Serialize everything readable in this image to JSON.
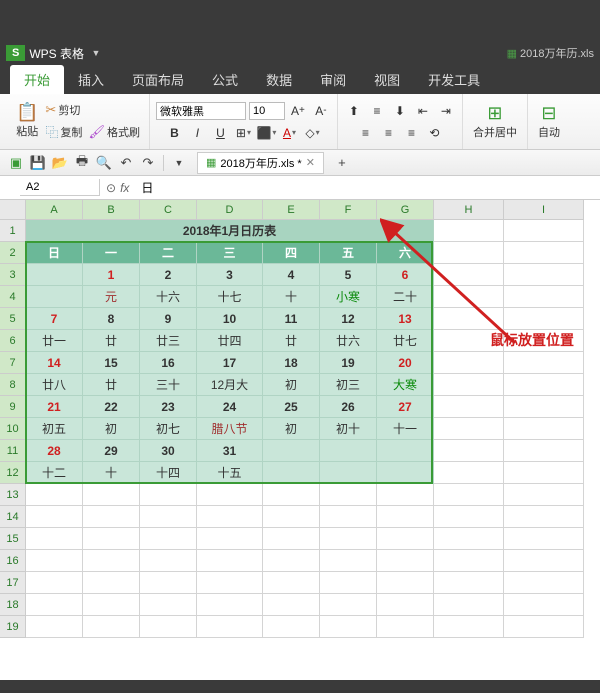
{
  "app": {
    "logo": "S",
    "title": "WPS 表格",
    "filename": "2018万年历.xls"
  },
  "menu": {
    "items": [
      "开始",
      "插入",
      "页面布局",
      "公式",
      "数据",
      "审阅",
      "视图",
      "开发工具"
    ],
    "active": 0
  },
  "ribbon": {
    "paste": "粘贴",
    "cut": "剪切",
    "copy": "复制",
    "format_painter": "格式刷",
    "font_name": "微软雅黑",
    "font_size": "10",
    "merge_center": "合并居中",
    "auto_wrap": "自动"
  },
  "qat": {
    "doc_tab": "2018万年历.xls *"
  },
  "name_box": "A2",
  "formula_value": "日",
  "col_headers": [
    "A",
    "B",
    "C",
    "D",
    "E",
    "F",
    "G",
    "H",
    "I"
  ],
  "row_headers": [
    "1",
    "2",
    "3",
    "4",
    "5",
    "6",
    "7",
    "8",
    "9",
    "10",
    "11",
    "12",
    "13",
    "14",
    "15",
    "16",
    "17",
    "18",
    "19"
  ],
  "calendar": {
    "title": "2018年1月日历表",
    "weekdays": [
      "日",
      "一",
      "二",
      "三",
      "四",
      "五",
      "六"
    ],
    "rows": [
      [
        {
          "t": ""
        },
        {
          "t": "1",
          "c": "red"
        },
        {
          "t": "2",
          "c": "bold"
        },
        {
          "t": "3",
          "c": "bold"
        },
        {
          "t": "4",
          "c": "bold"
        },
        {
          "t": "5",
          "c": "bold"
        },
        {
          "t": "6",
          "c": "red"
        }
      ],
      [
        {
          "t": ""
        },
        {
          "t": "元",
          "c": "darkred"
        },
        {
          "t": "十六"
        },
        {
          "t": "十七"
        },
        {
          "t": "十"
        },
        {
          "t": "小寒",
          "c": "green"
        },
        {
          "t": "二十"
        }
      ],
      [
        {
          "t": "7",
          "c": "red"
        },
        {
          "t": "8",
          "c": "bold"
        },
        {
          "t": "9",
          "c": "bold"
        },
        {
          "t": "10",
          "c": "bold"
        },
        {
          "t": "11",
          "c": "bold"
        },
        {
          "t": "12",
          "c": "bold"
        },
        {
          "t": "13",
          "c": "red"
        }
      ],
      [
        {
          "t": "廿一"
        },
        {
          "t": "廿"
        },
        {
          "t": "廿三"
        },
        {
          "t": "廿四"
        },
        {
          "t": "廿"
        },
        {
          "t": "廿六"
        },
        {
          "t": "廿七"
        }
      ],
      [
        {
          "t": "14",
          "c": "red"
        },
        {
          "t": "15",
          "c": "bold"
        },
        {
          "t": "16",
          "c": "bold"
        },
        {
          "t": "17",
          "c": "bold"
        },
        {
          "t": "18",
          "c": "bold"
        },
        {
          "t": "19",
          "c": "bold"
        },
        {
          "t": "20",
          "c": "red"
        }
      ],
      [
        {
          "t": "廿八"
        },
        {
          "t": "廿"
        },
        {
          "t": "三十"
        },
        {
          "t": "12月大"
        },
        {
          "t": "初"
        },
        {
          "t": "初三"
        },
        {
          "t": "大寒",
          "c": "green"
        }
      ],
      [
        {
          "t": "21",
          "c": "red"
        },
        {
          "t": "22",
          "c": "bold"
        },
        {
          "t": "23",
          "c": "bold"
        },
        {
          "t": "24",
          "c": "bold"
        },
        {
          "t": "25",
          "c": "bold"
        },
        {
          "t": "26",
          "c": "bold"
        },
        {
          "t": "27",
          "c": "red"
        }
      ],
      [
        {
          "t": "初五"
        },
        {
          "t": "初"
        },
        {
          "t": "初七"
        },
        {
          "t": "腊八节",
          "c": "darkred"
        },
        {
          "t": "初"
        },
        {
          "t": "初十"
        },
        {
          "t": "十一"
        }
      ],
      [
        {
          "t": "28",
          "c": "red"
        },
        {
          "t": "29",
          "c": "bold"
        },
        {
          "t": "30",
          "c": "bold"
        },
        {
          "t": "31",
          "c": "bold"
        },
        {
          "t": ""
        },
        {
          "t": ""
        },
        {
          "t": ""
        }
      ],
      [
        {
          "t": "十二"
        },
        {
          "t": "十"
        },
        {
          "t": "十四"
        },
        {
          "t": "十五"
        },
        {
          "t": ""
        },
        {
          "t": ""
        },
        {
          "t": ""
        }
      ]
    ]
  },
  "annotation": "鼠标放置位置"
}
